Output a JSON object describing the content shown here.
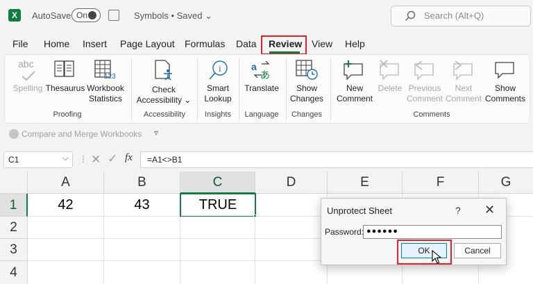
{
  "titlebar": {
    "app_logo": "X",
    "autosave_label": "AutoSave",
    "autosave_state": "On",
    "document_title": "Symbols • Saved ⌄",
    "search_placeholder": "Search (Alt+Q)"
  },
  "menu": {
    "items": [
      "File",
      "Home",
      "Insert",
      "Page Layout",
      "Formulas",
      "Data",
      "Review",
      "View",
      "Help"
    ],
    "active": "Review"
  },
  "ribbon": {
    "spelling_icon_text": "abc",
    "buttons": {
      "spelling": "Spelling",
      "thesaurus": "Thesaurus",
      "workbook_statistics_1": "Workbook",
      "workbook_statistics_2": "Statistics",
      "check_accessibility_1": "Check",
      "check_accessibility_2": "Accessibility ⌄",
      "smart_lookup_1": "Smart",
      "smart_lookup_2": "Lookup",
      "translate": "Translate",
      "show_changes_1": "Show",
      "show_changes_2": "Changes",
      "new_comment_1": "New",
      "new_comment_2": "Comment",
      "delete": "Delete",
      "previous_comment_1": "Previous",
      "previous_comment_2": "Comment",
      "next_comment_1": "Next",
      "next_comment_2": "Comment",
      "show_comments_1": "Show",
      "show_comments_2": "Comments"
    },
    "groups": {
      "proofing": "Proofing",
      "accessibility": "Accessibility",
      "insights": "Insights",
      "language": "Language",
      "changes": "Changes",
      "comments": "Comments"
    },
    "compare_merge": "Compare and Merge Workbooks"
  },
  "formula_bar": {
    "name_box": "C1",
    "fx": "fx",
    "formula": "=A1<>B1"
  },
  "sheet": {
    "columns": [
      "A",
      "B",
      "C",
      "D",
      "E",
      "F",
      "G"
    ],
    "rows": [
      "1",
      "2",
      "3",
      "4"
    ],
    "cells": {
      "A1": "42",
      "B1": "43",
      "C1": "TRUE"
    }
  },
  "dialog": {
    "title": "Unprotect Sheet",
    "help": "?",
    "close": "✕",
    "password_label": "Password:",
    "password_value": "●●●●●●",
    "ok": "OK",
    "cancel": "Cancel"
  },
  "colors": {
    "excel_green": "#107c41",
    "highlight_red": "#e0242b",
    "ok_blue": "#0078d4"
  }
}
